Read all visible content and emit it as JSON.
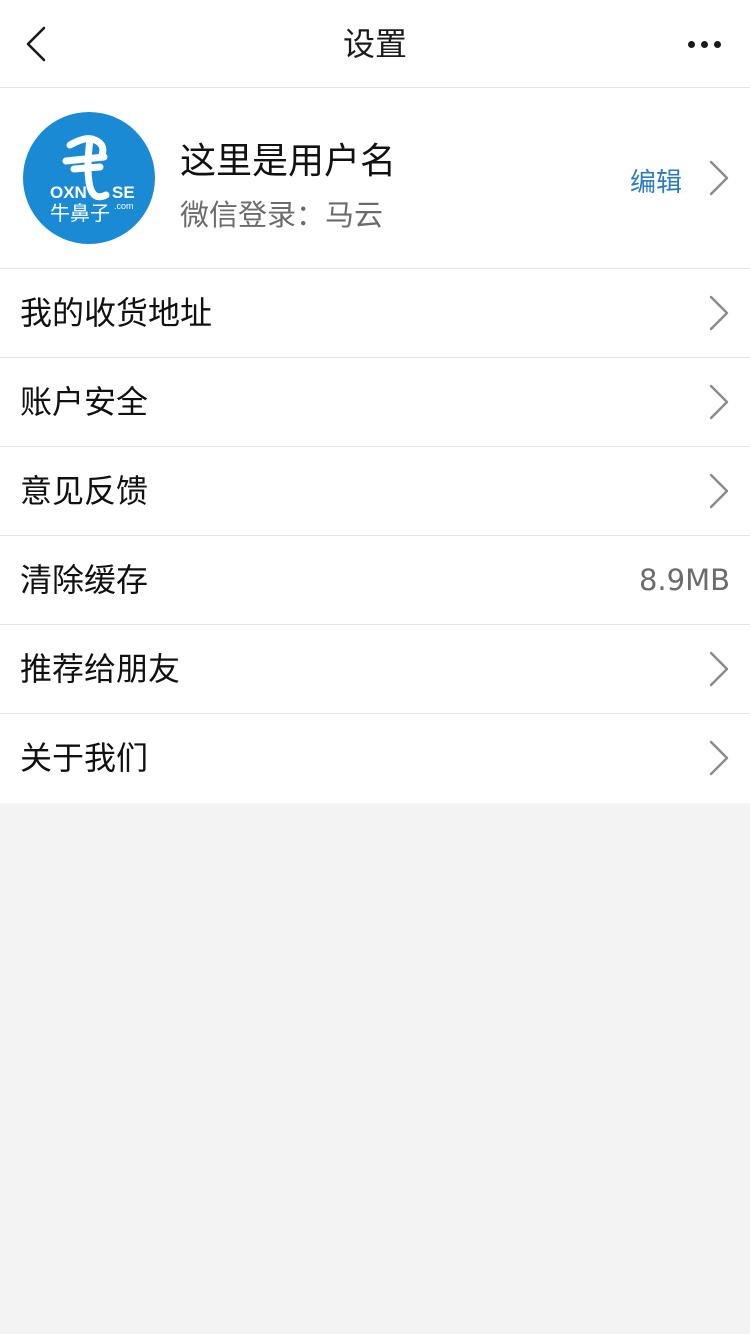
{
  "header": {
    "title": "设置"
  },
  "icons": {
    "back": "chevron-left-icon",
    "more": "more-horizontal-icon",
    "row_arrow": "chevron-right-icon"
  },
  "profile": {
    "username": "这里是用户名",
    "login_info": "微信登录：马云",
    "edit_label": "编辑",
    "avatar_logo": {
      "line1": "OXN",
      "line1b": "SE",
      "dotcom": ".com",
      "line2": "牛鼻子"
    }
  },
  "menu": {
    "items": [
      {
        "label": "我的收货地址"
      },
      {
        "label": "账户安全"
      },
      {
        "label": "意见反馈"
      },
      {
        "label": "清除缓存",
        "value": "8.9MB"
      },
      {
        "label": "推荐给朋友"
      },
      {
        "label": "关于我们"
      }
    ]
  },
  "colors": {
    "accent": "#2b7bbf",
    "logo_blue": "#1a8ad4",
    "background": "#f3f3f3"
  }
}
